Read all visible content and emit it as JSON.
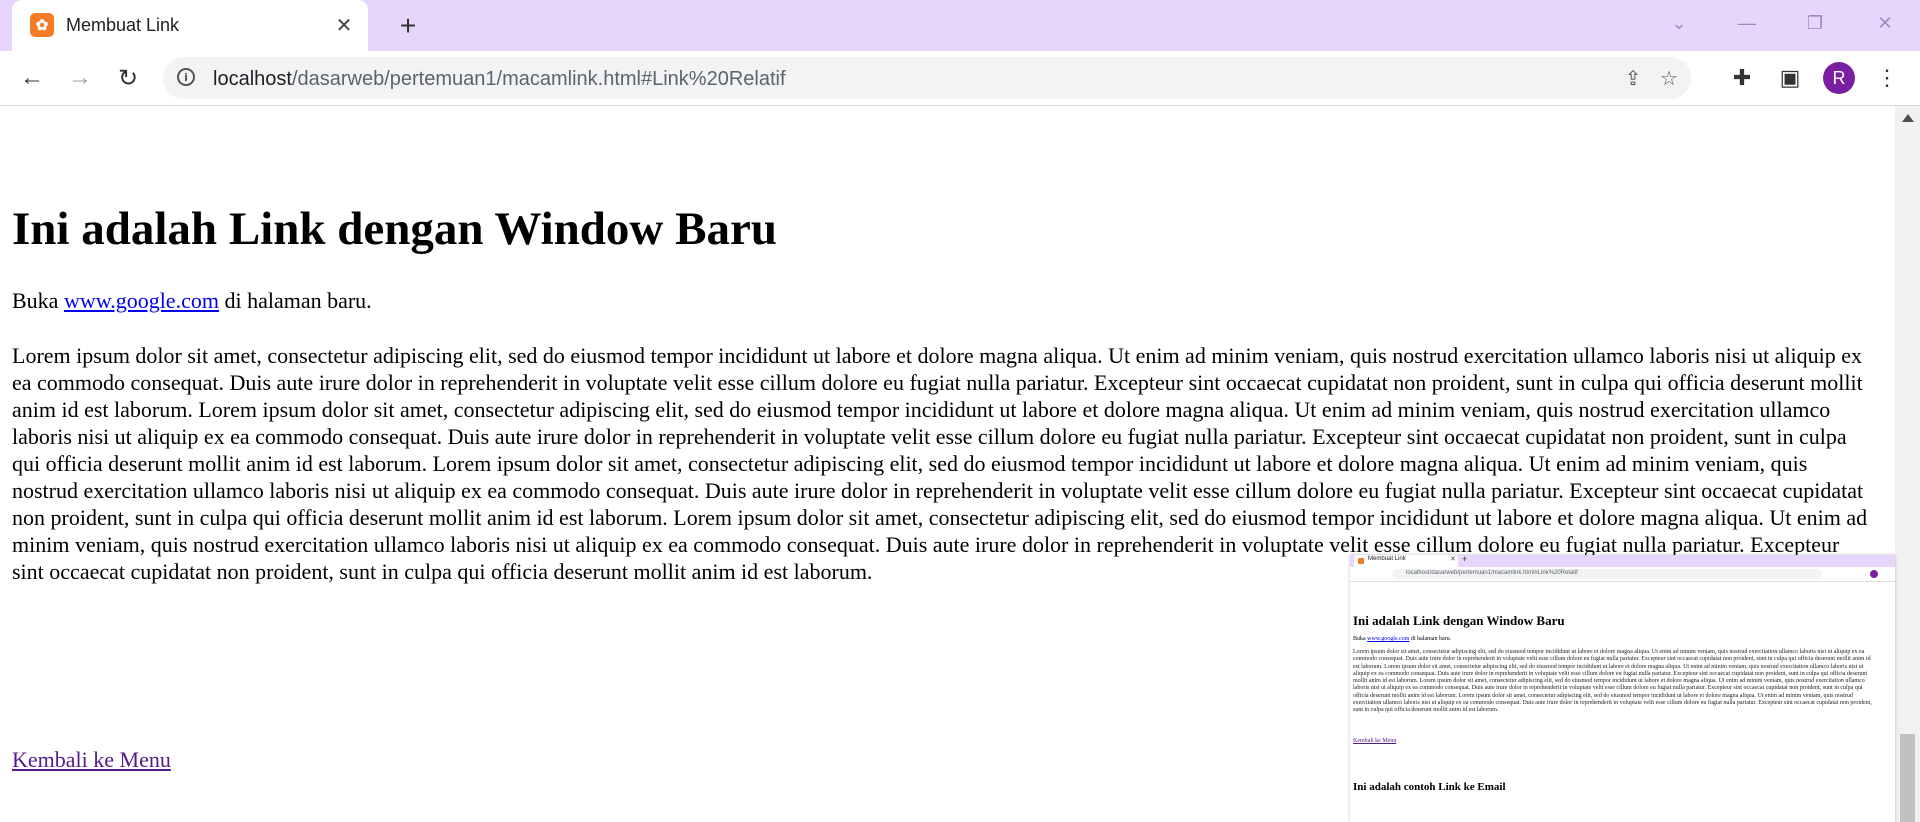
{
  "browser": {
    "tab_title": "Membuat Link",
    "tab_close": "✕",
    "new_tab": "+",
    "url_host": "localhost",
    "url_path": "/dasarweb/pertemuan1/macamlink.html#Link%20Relatif",
    "avatar_letter": "R",
    "colors": {
      "tabstrip": "#e6d6fb",
      "favicon": "#f57c25",
      "avatar": "#7b1fa2"
    }
  },
  "page": {
    "heading": "Ini adalah Link dengan Window Baru",
    "intro_prefix": "Buka ",
    "intro_link": "www.google.com",
    "intro_suffix": " di halaman baru.",
    "lorem": "Lorem ipsum dolor sit amet, consectetur adipiscing elit, sed do eiusmod tempor incididunt ut labore et dolore magna aliqua. Ut enim ad minim veniam, quis nostrud exercitation ullamco laboris nisi ut aliquip ex ea commodo consequat. Duis aute irure dolor in reprehenderit in voluptate velit esse cillum dolore eu fugiat nulla pariatur. Excepteur sint occaecat cupidatat non proident, sunt in culpa qui officia deserunt mollit anim id est laborum. Lorem ipsum dolor sit amet, consectetur adipiscing elit, sed do eiusmod tempor incididunt ut labore et dolore magna aliqua. Ut enim ad minim veniam, quis nostrud exercitation ullamco laboris nisi ut aliquip ex ea commodo consequat. Duis aute irure dolor in reprehenderit in voluptate velit esse cillum dolore eu fugiat nulla pariatur. Excepteur sint occaecat cupidatat non proident, sunt in culpa qui officia deserunt mollit anim id est laborum. Lorem ipsum dolor sit amet, consectetur adipiscing elit, sed do eiusmod tempor incididunt ut labore et dolore magna aliqua. Ut enim ad minim veniam, quis nostrud exercitation ullamco laboris nisi ut aliquip ex ea commodo consequat. Duis aute irure dolor in reprehenderit in voluptate velit esse cillum dolore eu fugiat nulla pariatur. Excepteur sint occaecat cupidatat non proident, sunt in culpa qui officia deserunt mollit anim id est laborum. Lorem ipsum dolor sit amet, consectetur adipiscing elit, sed do eiusmod tempor incididunt ut labore et dolore magna aliqua. Ut enim ad minim veniam, quis nostrud exercitation ullamco laboris nisi ut aliquip ex ea commodo consequat. Duis aute irure dolor in reprehenderit in voluptate velit esse cillum dolore eu fugiat nulla pariatur. Excepteur sint occaecat cupidatat non proident, sunt in culpa qui officia deserunt mollit anim id est laborum.",
    "back_link": "Kembali ke Menu"
  },
  "thumbnail": {
    "next_heading": "Ini adalah contoh Link ke Email"
  }
}
